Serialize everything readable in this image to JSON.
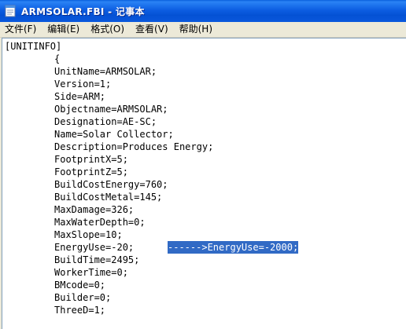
{
  "window": {
    "title": "ARMSOLAR.FBI - 记事本"
  },
  "menu": [
    "文件(F)",
    "编辑(E)",
    "格式(O)",
    "查看(V)",
    "帮助(H)"
  ],
  "editor": {
    "lines": [
      "[UNITINFO]",
      "{",
      "UnitName=ARMSOLAR;",
      "Version=1;",
      "Side=ARM;",
      "Objectname=ARMSOLAR;",
      "Designation=AE-SC;",
      "Name=Solar Collector;",
      "Description=Produces Energy;",
      "FootprintX=5;",
      "FootprintZ=5;",
      "BuildCostEnergy=760;",
      "BuildCostMetal=145;",
      "MaxDamage=326;",
      "MaxWaterDepth=0;",
      "MaxSlope=10;",
      "EnergyUse=-20;",
      "BuildTime=2495;",
      "WorkerTime=0;",
      "BMcode=0;",
      "Builder=0;",
      "ThreeD=1;"
    ],
    "selected_text": "------>EnergyUse=-2000;"
  }
}
